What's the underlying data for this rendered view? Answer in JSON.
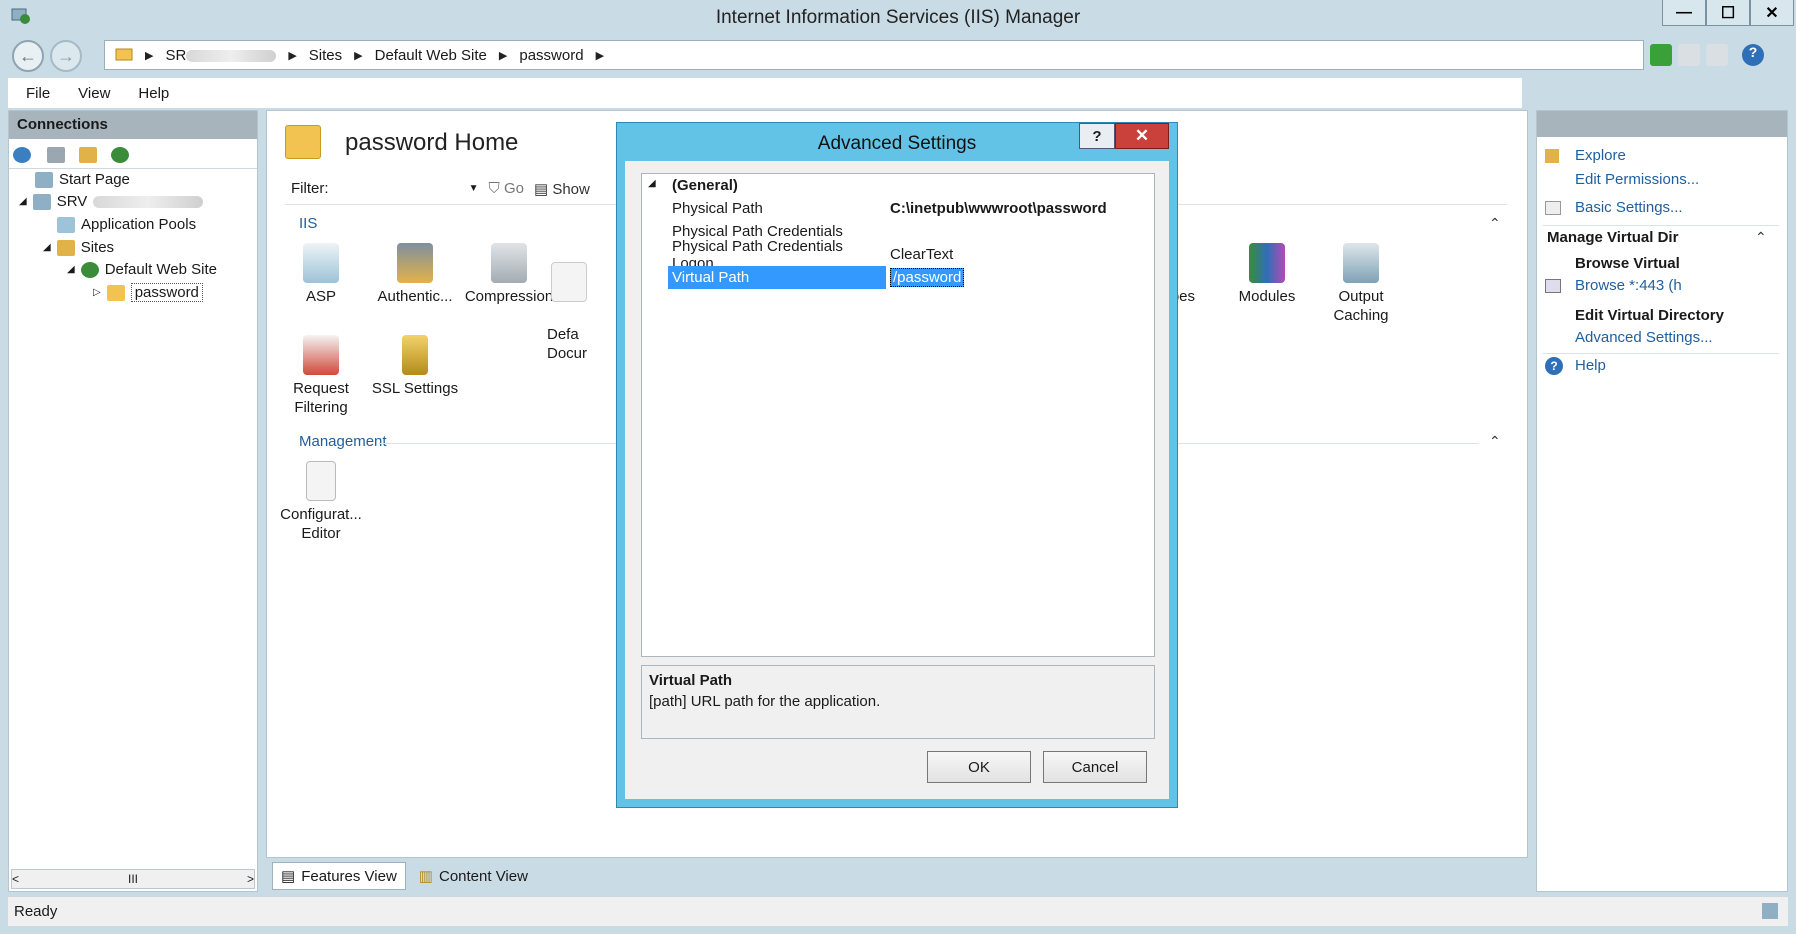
{
  "window": {
    "title": "Internet Information Services (IIS) Manager",
    "minimize": "—",
    "maximize": "☐",
    "close": "✕"
  },
  "address": {
    "crumbs": [
      "SR",
      "Sites",
      "Default Web Site",
      "password"
    ]
  },
  "menu": [
    "File",
    "View",
    "Help"
  ],
  "connections": {
    "header": "Connections",
    "tree": [
      {
        "label": "Start Page"
      },
      {
        "label": "SRV"
      },
      {
        "label": "Application Pools"
      },
      {
        "label": "Sites"
      },
      {
        "label": "Default Web Site"
      },
      {
        "label": "password"
      }
    ],
    "scroll_mid": "III"
  },
  "main": {
    "title": "password Home",
    "filter_label": "Filter:",
    "go_label": "Go",
    "show_label": "Show",
    "iis_group": "IIS",
    "management_group": "Management",
    "features_iis_row1": [
      "ASP",
      "Authentic...",
      "Compression",
      "Defa\nDocur"
    ],
    "features_iis_row1_right": [
      "Types",
      "Modules",
      "Output Caching"
    ],
    "features_iis_row2": [
      "Request Filtering",
      "SSL Settings"
    ],
    "features_mgmt": [
      "Configurat... Editor"
    ],
    "view_tabs": [
      "Features View",
      "Content View"
    ]
  },
  "actions": {
    "explore": "Explore",
    "edit_permissions": "Edit Permissions...",
    "basic_settings": "Basic Settings...",
    "manage_head": "Manage Virtual Dir",
    "browse_head": "Browse Virtual",
    "browse_link": "Browse *:443 (h",
    "edit_vd_head": "Edit Virtual Directory",
    "advanced_settings": "Advanced Settings...",
    "help": "Help"
  },
  "dialog": {
    "title": "Advanced Settings",
    "help_btn": "?",
    "close_btn": "✕",
    "section": "(General)",
    "rows": [
      {
        "name": "Physical Path",
        "value": "C:\\inetpub\\wwwroot\\password"
      },
      {
        "name": "Physical Path Credentials",
        "value": ""
      },
      {
        "name": "Physical Path Credentials Logon",
        "value": "ClearText"
      },
      {
        "name": "Virtual Path",
        "value": "/password"
      }
    ],
    "desc_title": "Virtual Path",
    "desc_text": "[path] URL path for the application.",
    "ok": "OK",
    "cancel": "Cancel"
  },
  "status": "Ready",
  "colors": {
    "chrome": "#c9dce6",
    "dialog_frame": "#63c3e6",
    "selection": "#3399ff",
    "link": "#1f5f9d",
    "close_red": "#c9413a"
  }
}
